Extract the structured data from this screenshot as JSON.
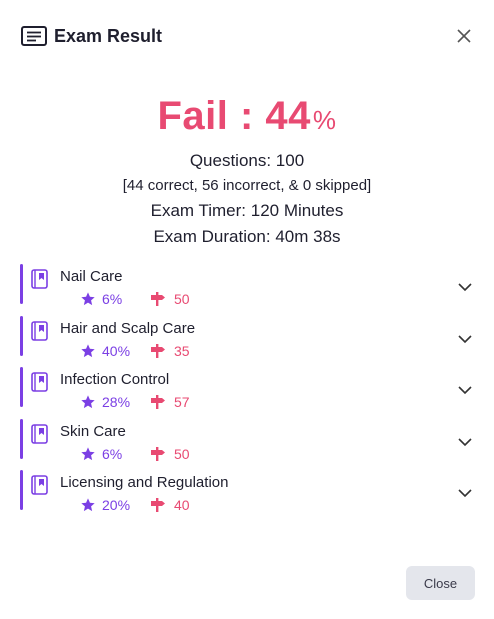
{
  "header": {
    "title": "Exam Result",
    "icon": "document-lines-icon",
    "close_icon": "close-icon"
  },
  "result": {
    "status": "Fail",
    "separator": " : ",
    "score": "44",
    "percent_sign": "%",
    "questions": "Questions: 100",
    "breakdown": "[44 correct, 56 incorrect, & 0 skipped]",
    "timer": "Exam Timer: 120 Minutes",
    "duration": "Exam Duration: 40m 38s"
  },
  "colors": {
    "fail": "#e84a72",
    "accent": "#7b3fe4"
  },
  "categories": [
    {
      "name": "Nail Care",
      "score": "6%",
      "count": "50"
    },
    {
      "name": "Hair and Scalp Care",
      "score": "40%",
      "count": "35"
    },
    {
      "name": "Infection Control",
      "score": "28%",
      "count": "57"
    },
    {
      "name": "Skin Care",
      "score": "6%",
      "count": "50"
    },
    {
      "name": "Licensing and Regulation",
      "score": "20%",
      "count": "40"
    }
  ],
  "footer": {
    "close_label": "Close"
  }
}
